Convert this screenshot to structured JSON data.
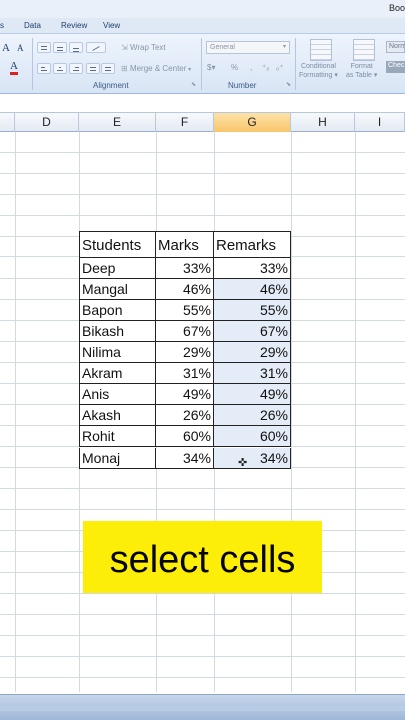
{
  "window": {
    "title_fragment": "Boo"
  },
  "ribbon": {
    "tabs": [
      "s",
      "Data",
      "Review",
      "View"
    ],
    "font_group": {
      "grow_label": "A",
      "shrink_label": "A",
      "font_color_label": "A"
    },
    "alignment": {
      "wrap_text_label": "Wrap Text",
      "merge_center_label": "Merge & Center",
      "group_label": "Alignment"
    },
    "number": {
      "format_value": "General",
      "percent_label": "%",
      "comma_label": ",",
      "group_label": "Number"
    },
    "styles": {
      "conditional_formatting_label_1": "Conditional",
      "conditional_formatting_label_2": "Formatting",
      "format_as_table_label_1": "Format",
      "format_as_table_label_2": "as Table",
      "style_normal": "Norm",
      "style_check": "Chec"
    }
  },
  "sheet": {
    "columns": [
      "D",
      "E",
      "F",
      "G",
      "H",
      "I"
    ],
    "selected_column": "G",
    "table": {
      "headers": [
        "Students",
        "Marks",
        "Remarks"
      ],
      "rows": [
        [
          "Deep",
          "33%",
          "33%"
        ],
        [
          "Mangal",
          "46%",
          "46%"
        ],
        [
          "Bapon",
          "55%",
          "55%"
        ],
        [
          "Bikash",
          "67%",
          "67%"
        ],
        [
          "Nilima",
          "29%",
          "29%"
        ],
        [
          "Akram",
          "31%",
          "31%"
        ],
        [
          "Anis",
          "49%",
          "49%"
        ],
        [
          "Akash",
          "26%",
          "26%"
        ],
        [
          "Rohit",
          "60%",
          "60%"
        ],
        [
          "Monaj",
          "34%",
          "34%"
        ]
      ]
    }
  },
  "caption": {
    "text": "select cells",
    "color": "#fdee0a"
  }
}
